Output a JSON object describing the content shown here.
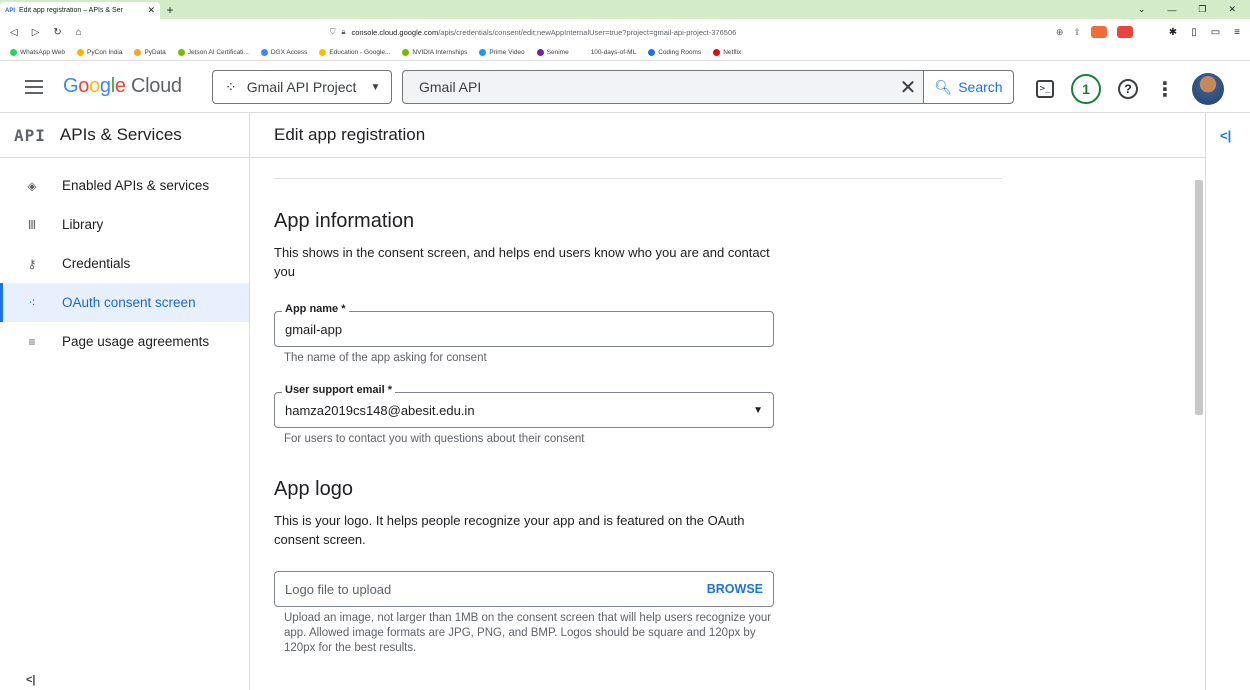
{
  "browser": {
    "tab_title": "Edit app registration – APIs & Ser",
    "tab_favicon": "API",
    "url_host": "console.cloud.google.com",
    "url_path": "/apis/credentials/consent/edit;newAppInternalUser=true?project=gmail-api-project-376506",
    "bookmarks": [
      {
        "label": "WhatsApp Web",
        "color": "#25d366"
      },
      {
        "label": "PyCon India",
        "color": "#f7b500"
      },
      {
        "label": "PyData",
        "color": "#f5a623"
      },
      {
        "label": "Jetson AI Certificati...",
        "color": "#76b900"
      },
      {
        "label": "DGX Access",
        "color": "#4285f4"
      },
      {
        "label": "Education - Google...",
        "color": "#fbbc04"
      },
      {
        "label": "NVIDIA Internships",
        "color": "#76b900"
      },
      {
        "label": "Prime Video",
        "color": "#1a98ff"
      },
      {
        "label": "Senime",
        "color": "#7b1fa2"
      },
      {
        "label": "100-days-of-ML",
        "color": "#ffffff"
      },
      {
        "label": "Coding Rooms",
        "color": "#1a73e8"
      },
      {
        "label": "Netflix",
        "color": "#e50914"
      }
    ]
  },
  "header": {
    "logo_google": "Google",
    "logo_cloud": "Cloud",
    "project": "Gmail API Project",
    "search_value": "Gmail API",
    "search_button": "Search",
    "notification_count": "1"
  },
  "sidebar": {
    "badge": "API",
    "title": "APIs & Services",
    "items": [
      {
        "label": "Enabled APIs & services",
        "icon": "diamond-arrows-icon"
      },
      {
        "label": "Library",
        "icon": "library-icon"
      },
      {
        "label": "Credentials",
        "icon": "key-icon"
      },
      {
        "label": "OAuth consent screen",
        "icon": "consent-dots-icon"
      },
      {
        "label": "Page usage agreements",
        "icon": "settings-list-icon"
      }
    ],
    "active_index": 3
  },
  "main": {
    "page_title": "Edit app registration",
    "app_info": {
      "heading": "App information",
      "description": "This shows in the consent screen, and helps end users know who you are and contact you",
      "app_name_label": "App name *",
      "app_name_value": "gmail-app",
      "app_name_hint": "The name of the app asking for consent",
      "email_label": "User support email *",
      "email_value": "hamza2019cs148@abesit.edu.in",
      "email_hint": "For users to contact you with questions about their consent"
    },
    "app_logo": {
      "heading": "App logo",
      "description": "This is your logo. It helps people recognize your app and is featured on the OAuth consent screen.",
      "upload_placeholder": "Logo file to upload",
      "browse_label": "BROWSE",
      "upload_hint": "Upload an image, not larger than 1MB on the consent screen that will help users recognize your app. Allowed image formats are JPG, PNG, and BMP. Logos should be square and 120px by 120px for the best results."
    }
  }
}
